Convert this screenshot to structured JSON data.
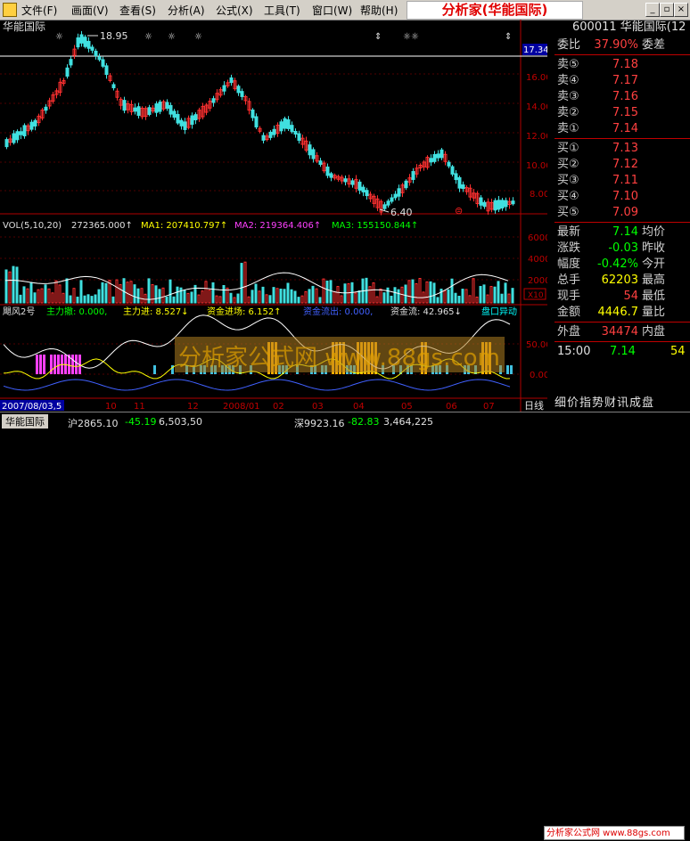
{
  "menu": {
    "items": [
      "文件(F)",
      "画面(V)",
      "查看(S)",
      "分析(A)",
      "公式(X)",
      "工具(T)",
      "窗口(W)",
      "帮助(H)"
    ],
    "brand": "分析家(华能国际)"
  },
  "chart": {
    "stock_name": "华能国际",
    "high_label": "18.95",
    "low_label": "6.40",
    "price_ticks": [
      "17.343",
      "16.00",
      "14.00",
      "12.00",
      "10.00",
      "8.00"
    ],
    "vol_header": {
      "prefix": "VOL(5,10,20)",
      "v0": "272365.000↑",
      "ma1": "MA1: 207410.797↑",
      "ma2": "MA2: 219364.406↑",
      "ma3": "MA3: 155150.844↑"
    },
    "vol_ticks": [
      "60000",
      "40000",
      "20000"
    ],
    "vol_unit": "X10",
    "ind_header": {
      "name": "飓风2号",
      "zlc": "主力撤: 0.000,",
      "zlj": "主力进: 8.527↓",
      "zjjc": "资金进场: 6.152↑",
      "zjlc": "资金流出: 0.000,",
      "zjl": "资金流: 42.965↓",
      "pkyd": "盘口异动"
    },
    "ind_ticks": [
      "50.00",
      "0.00"
    ],
    "watermark": "分析家公式网 www.88gs.com",
    "date_tag": "2007/08/03,5",
    "time_labels": [
      "10",
      "11",
      "12",
      "2008/01",
      "02",
      "03",
      "04",
      "05",
      "06",
      "07"
    ],
    "right_tag": "日线"
  },
  "panel": {
    "code": "600011 华能国际(12",
    "wb_label": "委比",
    "wb_value": "37.90%",
    "wc_label": "委差",
    "sell": [
      {
        "label": "卖⑤",
        "price": "7.18"
      },
      {
        "label": "卖④",
        "price": "7.17"
      },
      {
        "label": "卖③",
        "price": "7.16"
      },
      {
        "label": "卖②",
        "price": "7.15"
      },
      {
        "label": "卖①",
        "price": "7.14"
      }
    ],
    "buy": [
      {
        "label": "买①",
        "price": "7.13"
      },
      {
        "label": "买②",
        "price": "7.12"
      },
      {
        "label": "买③",
        "price": "7.11"
      },
      {
        "label": "买④",
        "price": "7.10"
      },
      {
        "label": "买⑤",
        "price": "7.09"
      }
    ],
    "stats": [
      {
        "l1": "最新",
        "v1": "7.14",
        "l2": "均价",
        "c": "#00ff00"
      },
      {
        "l1": "涨跌",
        "v1": "-0.03",
        "l2": "昨收",
        "c": "#00ff00"
      },
      {
        "l1": "幅度",
        "v1": "-0.42%",
        "l2": "今开",
        "c": "#00ff00"
      },
      {
        "l1": "总手",
        "v1": "62203",
        "l2": "最高",
        "c": "#ffff00"
      },
      {
        "l1": "现手",
        "v1": "54",
        "l2": "最低",
        "c": "#ff4040"
      },
      {
        "l1": "金额",
        "v1": "4446.7",
        "l2": "量比",
        "c": "#ffff00"
      }
    ],
    "waipan_label": "外盘",
    "waipan_value": "34474",
    "neipan_label": "内盘",
    "tick_time": "15:00",
    "tick_price": "7.14",
    "tick_vol": "54"
  },
  "tabs": "细价指势财讯成盘",
  "status": {
    "tab": "华能国际",
    "sh": "沪2865.10",
    "sh_chg": "-45.19",
    "sh_vol": "6,503,50",
    "sz": "深9923.16",
    "sz_chg": "-82.83",
    "sz_vol": "3,464,225",
    "mini": "分析家公式网 www.88gs.com"
  }
}
